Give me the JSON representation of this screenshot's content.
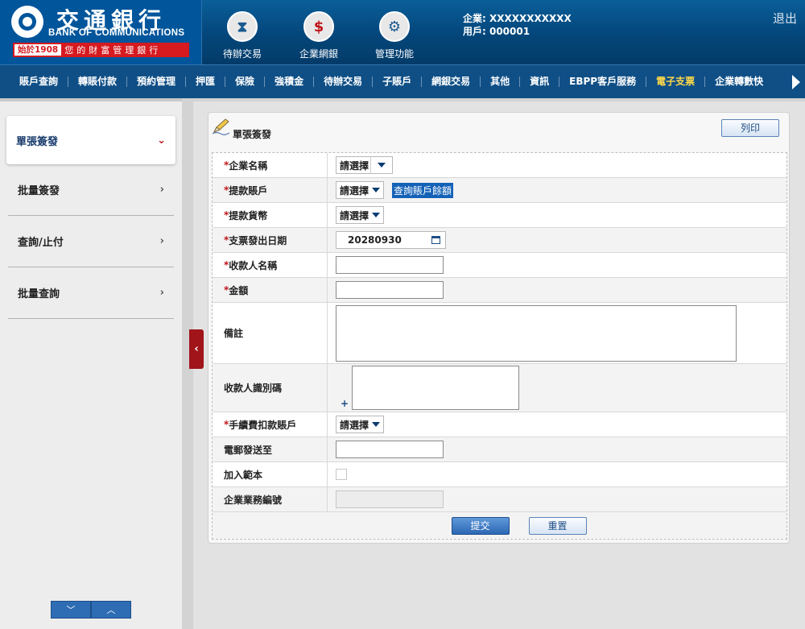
{
  "header": {
    "logo_cn": "交通銀行",
    "logo_en": "BANK OF COMMUNICATIONS",
    "logo_since": "始於1908",
    "logo_tagline": "您的財富管理銀行",
    "nav": [
      {
        "label": "待辦交易",
        "icon": "hourglass-icon",
        "glyph": "⧗"
      },
      {
        "label": "企業網銀",
        "icon": "monitor-dollar-icon",
        "glyph": "$"
      },
      {
        "label": "管理功能",
        "icon": "gears-icon",
        "glyph": "⚙"
      }
    ],
    "company": "企業: XXXXXXXXXXX",
    "user": "用戶: 000001",
    "logout": "退出"
  },
  "menu": {
    "items": [
      "賬戶查詢",
      "轉賬付款",
      "預約管理",
      "押匯",
      "保險",
      "強積金",
      "待辦交易",
      "子賬戶",
      "網銀交易",
      "其他",
      "資訊",
      "EBPP客戶服務",
      "電子支票",
      "企業轉數快"
    ],
    "active_index": 12
  },
  "sidebar": {
    "items": [
      {
        "label": "單張簽發",
        "active": true
      },
      {
        "label": "批量簽發"
      },
      {
        "label": "查詢/止付"
      },
      {
        "label": "批量查詢"
      }
    ]
  },
  "panel": {
    "title": "單張簽發",
    "print_label": "列印"
  },
  "form": {
    "company_name": {
      "label": "企業名稱",
      "value": "請選擇"
    },
    "debit_account": {
      "label": "提款賬戶",
      "value": "請選擇",
      "link": "查詢賬戶餘額"
    },
    "currency": {
      "label": "提款貨幣",
      "value": "請選擇"
    },
    "issue_date": {
      "label": "支票發出日期",
      "value": "20280930"
    },
    "payee_name": {
      "label": "收款人名稱"
    },
    "amount": {
      "label": "金額"
    },
    "remarks": {
      "label": "備註"
    },
    "payee_id": {
      "label": "收款人識別碼",
      "plus": "+"
    },
    "fee_account": {
      "label": "手續費扣款賬戶",
      "value": "請選擇"
    },
    "email_to": {
      "label": "電郵發送至"
    },
    "add_template": {
      "label": "加入範本"
    },
    "business_ref": {
      "label": "企業業務編號"
    },
    "required_mark": "*"
  },
  "actions": {
    "submit": "提交",
    "reset": "重置"
  }
}
